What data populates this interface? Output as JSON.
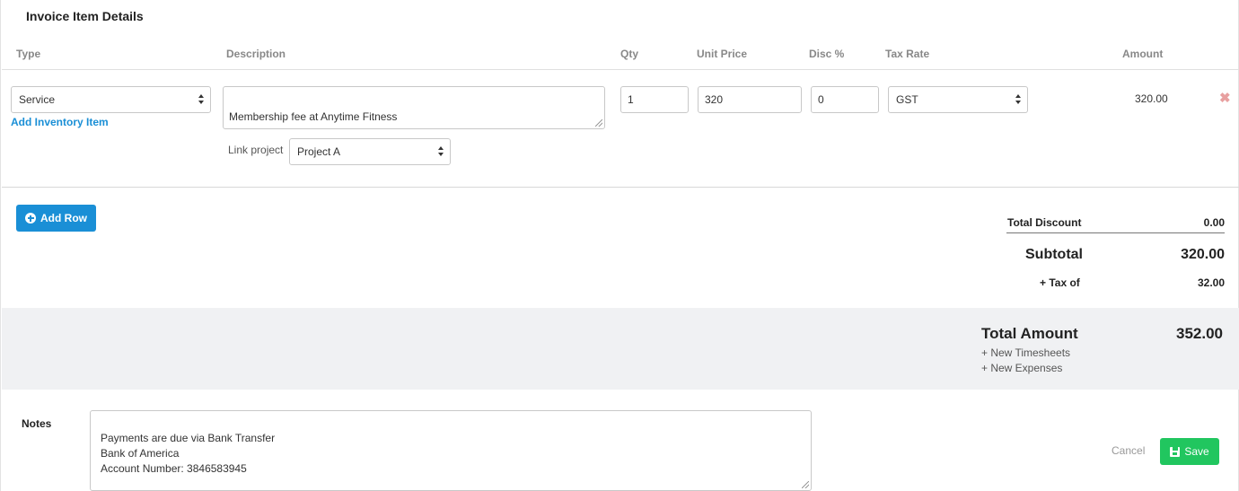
{
  "section_title": "Invoice Item Details",
  "columns": {
    "type": "Type",
    "description": "Description",
    "qty": "Qty",
    "unit_price": "Unit Price",
    "disc": "Disc %",
    "tax_rate": "Tax Rate",
    "amount": "Amount"
  },
  "row": {
    "type": "Service",
    "add_inventory": "Add Inventory Item",
    "description": "Membership fee at Anytime Fitness",
    "link_project_label": "Link project",
    "project": "Project A",
    "qty": "1",
    "unit_price": "320",
    "disc": "0",
    "tax_rate": "GST",
    "amount": "320.00",
    "remove_glyph": "✖"
  },
  "add_row_label": "Add Row",
  "summary": {
    "total_discount_label": "Total Discount",
    "total_discount_value": "0.00",
    "subtotal_label": "Subtotal",
    "subtotal_value": "320.00",
    "tax_label": "+ Tax of",
    "tax_value": "32.00",
    "total_amount_label": "Total Amount",
    "total_amount_value": "352.00",
    "new_timesheets": "+ New Timesheets",
    "new_expenses": "+ New Expenses"
  },
  "notes": {
    "label": "Notes",
    "text": "Payments are due via Bank Transfer\nBank of America\nAccount Number: 3846583945"
  },
  "actions": {
    "cancel": "Cancel",
    "save": "Save"
  },
  "colors": {
    "primary": "#1a8fd6",
    "success": "#21c65f",
    "remove": "#e8a0a0"
  }
}
